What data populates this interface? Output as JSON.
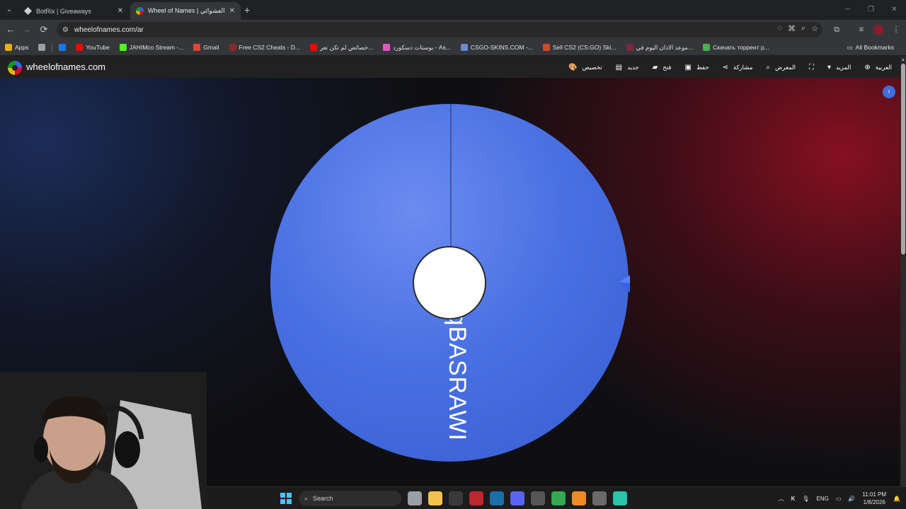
{
  "browser": {
    "tabs": [
      {
        "title": "BotRix | Giveaways",
        "active": false,
        "favicon_color": "#cfcfcf"
      },
      {
        "title": "Wheel of Names | اسم العشوائي",
        "active": true,
        "favicon_color": "#e04a3a"
      }
    ],
    "new_tab": "+",
    "window_controls": [
      "─",
      "❐",
      "✕"
    ],
    "url": "wheelofnames.com/ar",
    "nav": {
      "back": "←",
      "forward": "→",
      "reload": "⟳"
    },
    "omnibox_icons": [
      "hide-eye-icon",
      "translate-icon",
      "zoom-icon",
      "star-icon"
    ]
  },
  "bookmarks": {
    "items": [
      {
        "label": "Apps",
        "color": "#e8b000"
      },
      {
        "label": "",
        "color": "#9aa0a6"
      },
      {
        "label": "",
        "color": "#1877f2"
      },
      {
        "label": "YouTube",
        "color": "#ff0000"
      },
      {
        "label": "JAHIMco Stream -...",
        "color": "#53fc18"
      },
      {
        "label": "Gmail",
        "color": "#ea4335"
      },
      {
        "label": "Free CS2 Cheats - D...",
        "color": "#8a2a2a"
      },
      {
        "label": "خصائص لم تكن تعر...",
        "color": "#ff0000"
      },
      {
        "label": "بوستات دسكورد - As...",
        "color": "#e05ac0"
      },
      {
        "label": "CSGO-SKINS.COM -...",
        "color": "#6a8ad0"
      },
      {
        "label": "Sell CS2 (CS:GO) Ski...",
        "color": "#d04a2a"
      },
      {
        "label": "موعد الاذان اليوم في...",
        "color": "#7a2a3a"
      },
      {
        "label": "Скачать торрент p...",
        "color": "#4caf50"
      }
    ],
    "all_bookmarks": "All Bookmarks"
  },
  "site": {
    "brand": "wheelofnames.com",
    "menu": [
      {
        "label": "تخصيص",
        "icon": "palette-icon",
        "glyph": "🎨"
      },
      {
        "label": "جديد",
        "icon": "file-icon",
        "glyph": "▤"
      },
      {
        "label": "فتح",
        "icon": "folder-icon",
        "glyph": "▰"
      },
      {
        "label": "حفظ",
        "icon": "save-icon",
        "glyph": "▣"
      },
      {
        "label": "مشاركة",
        "icon": "share-icon",
        "glyph": "⋖"
      },
      {
        "label": "المعرض",
        "icon": "search-icon",
        "glyph": "⌕"
      },
      {
        "label": "",
        "icon": "fullscreen-icon",
        "glyph": "⛶"
      },
      {
        "label": "المزيد",
        "icon": "caret-down-icon",
        "glyph": "▾"
      },
      {
        "label": "العربية",
        "icon": "globe-icon",
        "glyph": "⊕"
      }
    ]
  },
  "wheel": {
    "entry": "iqBASRAWI",
    "color": "#4169e1",
    "pointer_color": "#3a63e0",
    "hub_color": "#ffffff"
  },
  "taskbar": {
    "search_placeholder": "Search",
    "apps": [
      {
        "name": "task-view",
        "color": "#9aa0a6"
      },
      {
        "name": "file-explorer",
        "color": "#f2c14e"
      },
      {
        "name": "g-hub",
        "color": "#3a3a3a"
      },
      {
        "name": "app-red",
        "color": "#c0262d"
      },
      {
        "name": "steam",
        "color": "#1b6fa8"
      },
      {
        "name": "discord",
        "color": "#5865f2"
      },
      {
        "name": "app-clock",
        "color": "#555555"
      },
      {
        "name": "chrome",
        "color": "#34a853"
      },
      {
        "name": "vlc",
        "color": "#f08a24"
      },
      {
        "name": "settings",
        "color": "#6a6a6a"
      },
      {
        "name": "app-teal",
        "color": "#29c4a9"
      }
    ],
    "tray": {
      "language": "ENG",
      "time": "11:01 PM",
      "date": "1/8/2026"
    }
  }
}
